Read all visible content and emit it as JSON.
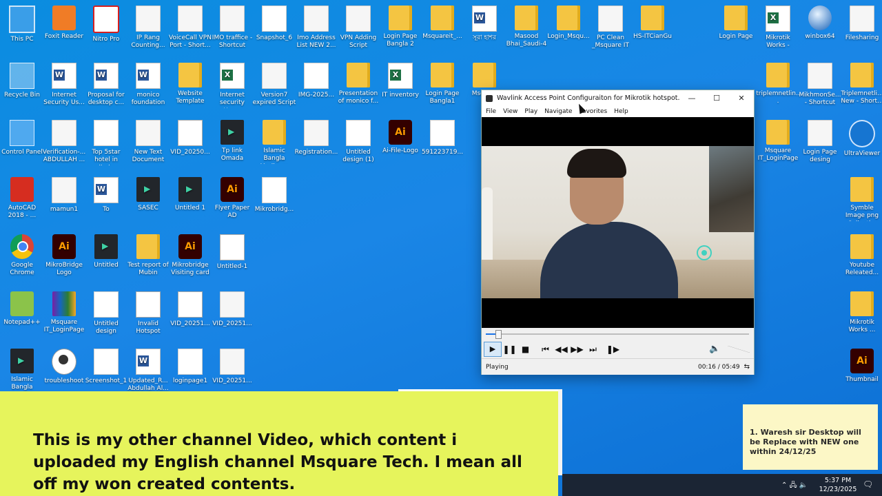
{
  "desktop": {
    "icons": [
      {
        "label": "This PC",
        "glyph": "pc"
      },
      {
        "label": "Foxit Reader",
        "glyph": "orange"
      },
      {
        "label": "Nitro Pro",
        "glyph": "nitro"
      },
      {
        "label": "IP Rang Counting...",
        "glyph": "file"
      },
      {
        "label": "VoiceCall VPN Port - Short...",
        "glyph": "file"
      },
      {
        "label": "IMO traffice - Shortcut",
        "glyph": "file"
      },
      {
        "label": "Snapshot_6",
        "glyph": "img"
      },
      {
        "label": "Imo Address List NEW 2...",
        "glyph": "file"
      },
      {
        "label": "VPN Adding Script",
        "glyph": "file"
      },
      {
        "label": "Login Page Bangla 2",
        "glyph": "folder"
      },
      {
        "label": "Msquareit_...",
        "glyph": "folder"
      },
      {
        "label": "সূরা হাশর",
        "glyph": "word"
      },
      {
        "label": "Masood Bhai_Saudi-4",
        "glyph": "folder"
      },
      {
        "label": "Login_Msqu...",
        "glyph": "folder"
      },
      {
        "label": "PC Clean _Msquare IT",
        "glyph": "file"
      },
      {
        "label": "HS-ITCianGu",
        "glyph": "folder"
      },
      {
        "label": "Login Page",
        "glyph": "folder"
      },
      {
        "label": "Mikrotik Works -",
        "glyph": "excel"
      },
      {
        "label": "winbox64",
        "glyph": "winbox"
      },
      {
        "label": "Filesharing",
        "glyph": "file"
      },
      {
        "label": "Recycle Bin",
        "glyph": "recycle"
      },
      {
        "label": "Internet Security Us...",
        "glyph": "word"
      },
      {
        "label": "Proposal for desktop c...",
        "glyph": "word"
      },
      {
        "label": "monico foundation",
        "glyph": "word"
      },
      {
        "label": "Website Template",
        "glyph": "folder"
      },
      {
        "label": "Internet security Use...",
        "glyph": "excel"
      },
      {
        "label": "Version7 expired Script",
        "glyph": "file"
      },
      {
        "label": "IMG-2025...",
        "glyph": "img"
      },
      {
        "label": "Presentation of monico f...",
        "glyph": "folder"
      },
      {
        "label": "IT inventory",
        "glyph": "excel"
      },
      {
        "label": "Login Page Bangla1",
        "glyph": "folder"
      },
      {
        "label": "Msq IT-L",
        "glyph": "folder"
      },
      {
        "label": "triplemnetlin...",
        "glyph": "folder"
      },
      {
        "label": "MikhmonSe... - Shortcut",
        "glyph": "file"
      },
      {
        "label": "Triplemnetli... New - Short...",
        "glyph": "folder"
      },
      {
        "label": "Control Panel",
        "glyph": "cp"
      },
      {
        "label": "Verification-... ABDULLAH ...",
        "glyph": "file"
      },
      {
        "label": "Top 5star hotel in dhaka",
        "glyph": "img"
      },
      {
        "label": "New Text Document",
        "glyph": "file"
      },
      {
        "label": "VID_20250...",
        "glyph": "blank"
      },
      {
        "label": "Tp link Omada",
        "glyph": "vid"
      },
      {
        "label": "Islamic Bangla Medioum",
        "glyph": "folder"
      },
      {
        "label": "Registration...",
        "glyph": "file"
      },
      {
        "label": "Untitled design (1)",
        "glyph": "img"
      },
      {
        "label": "Ai-File-Logo",
        "glyph": "ai"
      },
      {
        "label": "591223719...",
        "glyph": "img"
      },
      {
        "label": "Msquare IT_LoginPage",
        "glyph": "folder"
      },
      {
        "label": "Login Page desing",
        "glyph": "file"
      },
      {
        "label": "UltraViewer",
        "glyph": "ultra"
      },
      {
        "label": "AutoCAD 2018 - ...",
        "glyph": "red"
      },
      {
        "label": "mamun1",
        "glyph": "file"
      },
      {
        "label": "To",
        "glyph": "word"
      },
      {
        "label": "SASEC",
        "glyph": "vid"
      },
      {
        "label": "Untitled 1",
        "glyph": "vid"
      },
      {
        "label": "Flyer Paper AD",
        "glyph": "ai"
      },
      {
        "label": "Mikrobridg...",
        "glyph": "img"
      },
      {
        "label": "Symble Image png Collecti...",
        "glyph": "folder"
      },
      {
        "label": "Google Chrome",
        "glyph": "chrome"
      },
      {
        "label": "MikroBridge Logo",
        "glyph": "ai"
      },
      {
        "label": "Untitled",
        "glyph": "vid"
      },
      {
        "label": "Test report of Mubin",
        "glyph": "folder"
      },
      {
        "label": "Mikrobridge Visiting card",
        "glyph": "ai"
      },
      {
        "label": "Untitled-1",
        "glyph": "blank"
      },
      {
        "label": "Youtube Releated...",
        "glyph": "folder"
      },
      {
        "label": "Notepad++",
        "glyph": "notepad"
      },
      {
        "label": "Msquare IT_LoginPage",
        "glyph": "zip"
      },
      {
        "label": "Untitled design",
        "glyph": "img"
      },
      {
        "label": "Invalid Hotspot",
        "glyph": "blank"
      },
      {
        "label": "VID_20251...",
        "glyph": "blank"
      },
      {
        "label": "VID_20251...",
        "glyph": "file"
      },
      {
        "label": "Mikrotik Works ...",
        "glyph": "folder"
      },
      {
        "label": "Islamic Bangla MediumTem...",
        "glyph": "vid"
      },
      {
        "label": "troubleshoot",
        "glyph": "play"
      },
      {
        "label": "Screenshot_1",
        "glyph": "img"
      },
      {
        "label": "Updated_R... Abdullah Al...",
        "glyph": "word"
      },
      {
        "label": "loginpage1",
        "glyph": "img"
      },
      {
        "label": "VID_20251...",
        "glyph": "file"
      },
      {
        "label": "Thumbnail",
        "glyph": "ai"
      }
    ]
  },
  "player": {
    "title": "Wavlink Access Point Configuraiton for Mikrotik hotspot.mp4",
    "window_buttons": {
      "minimize": "—",
      "maximize": "☐",
      "close": "✕"
    },
    "menu": [
      "File",
      "View",
      "Play",
      "Navigate",
      "Favorites",
      "Help"
    ],
    "progress_fraction": 0.046,
    "controls": {
      "play": "▶",
      "pause": "❚❚",
      "stop": "■",
      "prev": "⏮",
      "rewind": "◀◀",
      "forward": "▶▶",
      "next": "⏭",
      "frame": "❚▶",
      "volume": "🔈"
    },
    "status": "Playing",
    "time": "00:16 / 05:49",
    "status_icon": "⇆"
  },
  "caption": {
    "text": "This is my other channel Video, which content i uploaded my English channel Msquare Tech. I mean all off my won created contents."
  },
  "sticky_note": {
    "text": "1. Waresh sir Desktop will be Replace with NEW one within 24/12/25"
  },
  "taskbar": {
    "tray_icons": "⌃  🖧  🔈",
    "time": "5:37 PM",
    "date": "12/23/2025",
    "notify_icon": "🗨"
  }
}
